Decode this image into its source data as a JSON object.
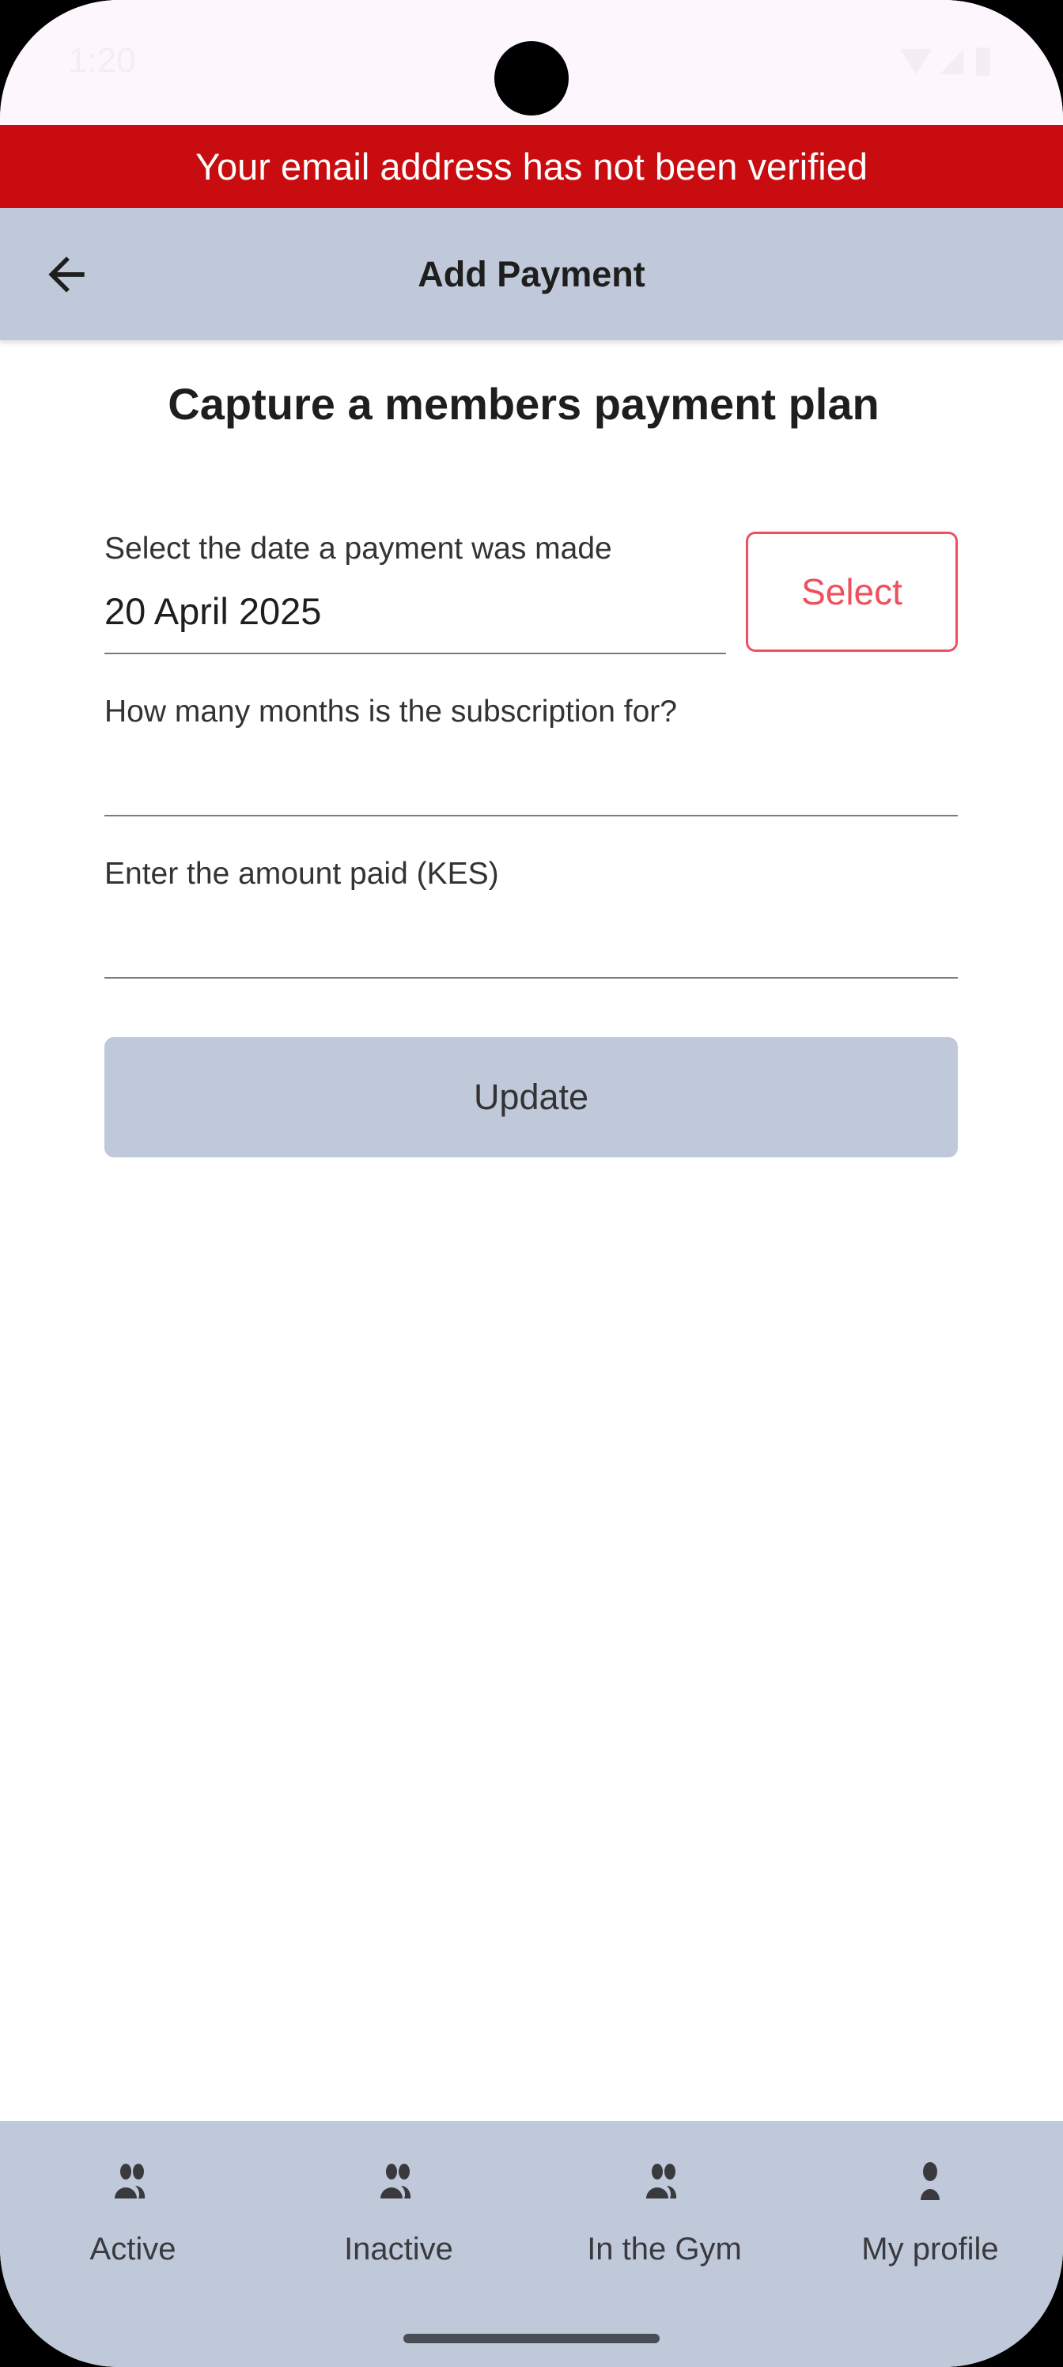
{
  "status_bar": {
    "time": "1:20"
  },
  "banner": {
    "text": "Your email address has not been verified",
    "color": "#c90c0f"
  },
  "app_bar": {
    "title": "Add Payment",
    "back_icon": "arrow-left-icon"
  },
  "heading": "Capture a members payment plan",
  "form": {
    "date": {
      "label": "Select the date a payment was made",
      "value": "20 April 2025",
      "button": "Select"
    },
    "months": {
      "label": "How many months is the subscription for?",
      "value": ""
    },
    "amount": {
      "label": "Enter the amount paid (KES)",
      "value": ""
    },
    "submit": "Update"
  },
  "bottom_nav": {
    "items": [
      {
        "label": "Active",
        "icon": "group-icon"
      },
      {
        "label": "Inactive",
        "icon": "group-icon"
      },
      {
        "label": "In the Gym",
        "icon": "group-icon"
      },
      {
        "label": "My profile",
        "icon": "person-icon"
      }
    ]
  },
  "colors": {
    "accent": "#f0505e",
    "bar": "#c0c9da"
  }
}
